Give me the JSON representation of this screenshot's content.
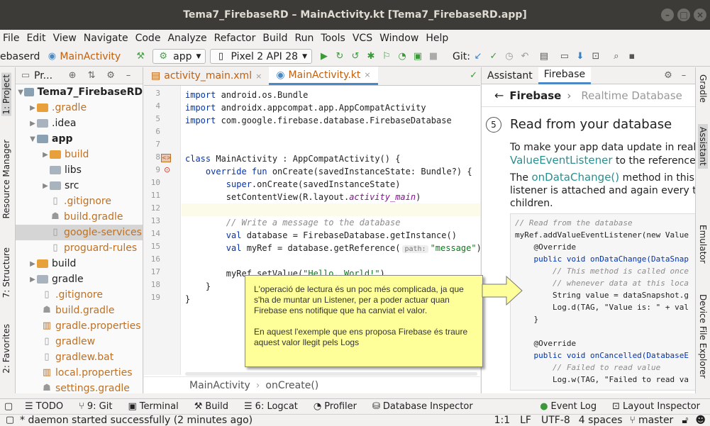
{
  "window": {
    "title": "Tema7_FirebaseRD – MainActivity.kt [Tema7_FirebaseRD.app]"
  },
  "menu": [
    "File",
    "Edit",
    "View",
    "Navigate",
    "Code",
    "Analyze",
    "Refactor",
    "Build",
    "Run",
    "Tools",
    "VCS",
    "Window",
    "Help"
  ],
  "toolbar": {
    "crumb1": "ebaserd",
    "crumb2": "MainActivity",
    "module": "app",
    "device": "Pixel 2 API 28",
    "git_label": "Git:"
  },
  "left_tabs": {
    "project": "1: Project",
    "resource": "Resource Manager",
    "structure": "7: Structure",
    "favorites": "2: Favorites"
  },
  "project": {
    "header": "Pr...",
    "rows": [
      {
        "label": "Tema7_FirebaseRD"
      },
      {
        "label": ".gradle"
      },
      {
        "label": ".idea"
      },
      {
        "label": "app"
      },
      {
        "label": "build"
      },
      {
        "label": "libs"
      },
      {
        "label": "src"
      },
      {
        "label": ".gitignore"
      },
      {
        "label": "build.gradle"
      },
      {
        "label": "google-services"
      },
      {
        "label": "proguard-rules"
      },
      {
        "label": "build"
      },
      {
        "label": "gradle"
      },
      {
        "label": ".gitignore"
      },
      {
        "label": "build.gradle"
      },
      {
        "label": "gradle.properties"
      },
      {
        "label": "gradlew"
      },
      {
        "label": "gradlew.bat"
      },
      {
        "label": "local.properties"
      },
      {
        "label": "settings.gradle"
      }
    ]
  },
  "editor": {
    "tabs": [
      {
        "label": "activity_main.xml"
      },
      {
        "label": "MainActivity.kt"
      }
    ],
    "line_numbers": [
      "3",
      "4",
      "5",
      "6",
      "7",
      "8",
      "9",
      "10",
      "11",
      "12",
      "13",
      "14",
      "15",
      "16",
      "17",
      "18",
      "19"
    ],
    "breadcrumb": [
      "MainActivity",
      "onCreate()"
    ],
    "hint": "path:",
    "code": {
      "l3a": "import ",
      "l3b": "android.os.Bundle",
      "l4a": "import ",
      "l4b": "androidx.appcompat.app.AppCompatActivity",
      "l5a": "import ",
      "l5b": "com.google.firebase.database.FirebaseDatabase",
      "l8a": "class ",
      "l8b": "MainActivity : AppCompatActivity() {",
      "l9a": "    override fun ",
      "l9b": "onCreate(savedInstanceState: Bundle?) {",
      "l10a": "        super",
      "l10b": ".onCreate(savedInstanceState)",
      "l11a": "        setContentView(R.layout.",
      "l11b": "activity_main",
      "l11c": ")",
      "l13": "        // Write a message to the database",
      "l14a": "        val ",
      "l14b": "database = FirebaseDatabase.getInstance()",
      "l15a": "        val ",
      "l15b": "myRef = database.getReference(",
      "l15c": "\"message\"",
      "l15d": ")",
      "l17a": "        myRef.setValue(",
      "l17b": "\"Hello, World!\"",
      "l17c": ")",
      "l18": "    }",
      "l19": "}"
    }
  },
  "assistant": {
    "tabs": [
      "Assistant",
      "Firebase"
    ],
    "nav_back": "Firebase",
    "nav_current": "Realtime Database",
    "step_num": "5",
    "step_title": "Read from your database",
    "p1a": "To make your app data update in realti",
    "p1b": "ValueEventListener",
    "p1c": " to the reference",
    "p2a": "The ",
    "p2b": "onDataChange()",
    "p2c": " method in this c",
    "p2d": "listener is attached and again every tim",
    "p2e": "children.",
    "code": [
      "// Read from the database",
      "myRef.addValueEventListener(new Value",
      "    @Override",
      "    public void onDataChange(DataSnap",
      "        // This method is called once",
      "        // whenever data at this loca",
      "        String value = dataSnapshot.g",
      "        Log.d(TAG, \"Value is: \" + val",
      "    }",
      "",
      "    @Override",
      "    public void onCancelled(DatabaseE",
      "        // Failed to read value",
      "        Log.w(TAG, \"Failed to read va"
    ]
  },
  "right_tabs": {
    "gradle": "Gradle",
    "assistant": "Assistant",
    "emulator": "Emulator",
    "device": "Device File Explorer"
  },
  "bottom_tabs": [
    "TODO",
    "9: Git",
    "Terminal",
    "Build",
    "6: Logcat",
    "Profiler",
    "Database Inspector",
    "Event Log",
    "Layout Inspector"
  ],
  "status": {
    "message": "* daemon started successfully (2 minutes ago)",
    "position": "1:1",
    "line_sep": "LF",
    "encoding": "UTF-8",
    "indent": "4 spaces",
    "branch": "master"
  },
  "callout": {
    "p1": "L'operació de lectura és un poc més complicada, ja que s'ha de muntar un Listener, per a poder actuar quan Firebase ens notifique que ha canviat el valor.",
    "p2": "En aquest l'exemple que ens proposa Firebase és traure aquest valor llegit pels Logs"
  },
  "colors": {
    "accent": "#4a88c7",
    "callout_bg": "#ffff99",
    "kotlin_keyword": "#0033b3",
    "string": "#067d17",
    "link": "#2a8f8f"
  }
}
